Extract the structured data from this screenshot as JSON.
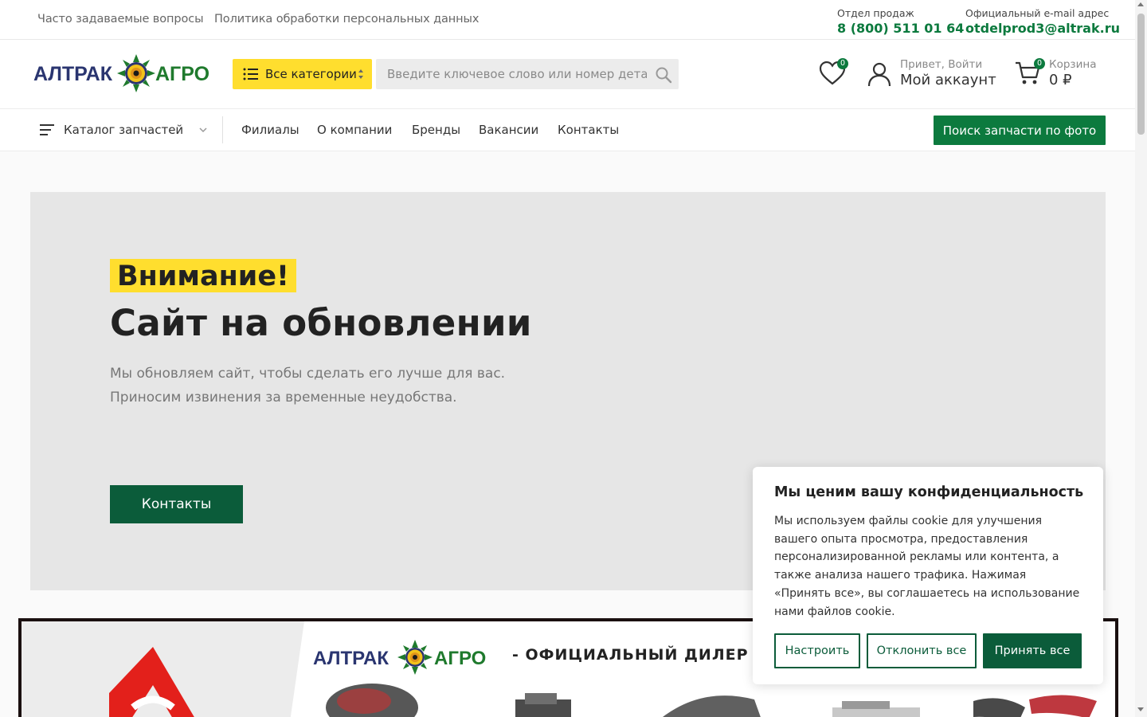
{
  "topbar": {
    "links": [
      "Часто задаваемые вопросы",
      "Политика обработки персональных данных"
    ],
    "sales": {
      "label": "Отдел продаж",
      "value": "8 (800) 511 01 64"
    },
    "email": {
      "label": "Официальный e-mail адрес",
      "value": "otdelprod3@altrak.ru"
    }
  },
  "header": {
    "logo_text_left": "АЛТРАК",
    "logo_text_right": "АГРО",
    "categories_label": "Все категории",
    "search_placeholder": "Введите ключевое слово или номер детали",
    "wishlist_count": "0",
    "account_greeting": "Привет, Войти",
    "account_label": "Мой аккаунт",
    "cart_count": "0",
    "cart_label": "Корзина",
    "cart_total": "0 ₽"
  },
  "nav": {
    "catalog_label": "Каталог запчастей",
    "items": [
      "Филиалы",
      "О компании",
      "Бренды",
      "Вакансии",
      "Контакты"
    ],
    "photo_search_label": "Поиск запчасти по фото"
  },
  "hero": {
    "attention": "Внимание!",
    "title": "Сайт на обновлении",
    "desc_line1": "Мы обновляем сайт, чтобы сделать его лучше для вас.",
    "desc_line2": "Приносим извинения за временные неудобства.",
    "button_label": "Контакты"
  },
  "banner": {
    "logo_text_left": "АЛТРАК",
    "logo_text_right": "АГРО",
    "dealer_text": "- ОФИЦИАЛЬНЫЙ ДИЛЕР"
  },
  "cookie": {
    "title": "Мы ценим вашу конфиденциальность",
    "text": "Мы используем файлы cookie для улучшения вашего опыта просмотра, предоставления персонализированной рекламы или контента, а также анализа нашего трафика. Нажимая «Принять все», вы соглашаетесь на использование нами файлов cookie.",
    "customize_label": "Настроить",
    "reject_label": "Отклонить все",
    "accept_label": "Принять все"
  },
  "colors": {
    "brand_green": "#0c7a3e",
    "dark_green": "#0b5c3a",
    "accent_yellow": "#ffde2e",
    "logo_navy": "#2a3570"
  }
}
